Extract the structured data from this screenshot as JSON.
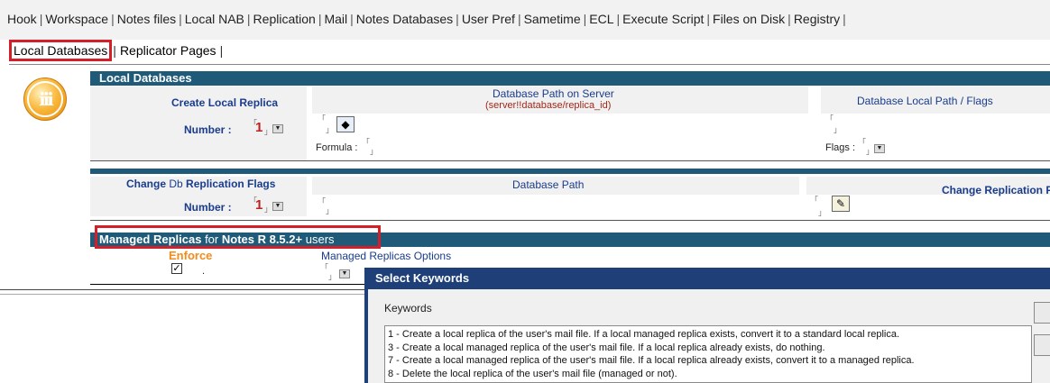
{
  "top_tabs": [
    "Hook",
    "Workspace",
    "Notes files",
    "Local NAB",
    "Replication",
    "Mail",
    "Notes Databases",
    "User Pref",
    "Sametime",
    "ECL",
    "Execute Script",
    "Files on Disk",
    "Registry"
  ],
  "sub_tabs": {
    "active": "Local Databases",
    "other": "Replicator Pages"
  },
  "local_databases": {
    "header": "Local Databases",
    "create_label": "Create Local Replica",
    "number_label": "Number :",
    "number_value": "1",
    "path_server_title": "Database Path on Server",
    "path_server_hint": "(server!!database/replica_id)",
    "formula_label": "Formula :",
    "local_path_title": "Database Local Path / Flags",
    "flags_label": "Flags :"
  },
  "change_flags": {
    "label_bold_1": "Change",
    "label_normal": "Db",
    "label_bold_2": "Replication Flags",
    "number_label": "Number :",
    "number_value": "1",
    "path_title": "Database Path",
    "change_title": "Change Replication F"
  },
  "managed": {
    "header_bold": "Managed Replicas",
    "header_normal_1": "for",
    "header_bold_2": "Notes R 8.5.2+",
    "header_normal_2": "users",
    "enforce_label": "Enforce",
    "options_label": "Managed Replicas Options",
    "enforce_checked": true
  },
  "dialog": {
    "title": "Select Keywords",
    "keywords_label": "Keywords",
    "items": [
      "1 - Create a local replica of the user's mail file. If a local managed replica exists, convert it to a standard local replica.",
      "3 - Create a local managed replica of the user's mail file. If a local replica already exists, do nothing.",
      "7 - Create a local managed replica of the user's mail file. If a local replica already exists, convert it to a managed replica.",
      "8 - Delete the local replica of the user's mail file (managed or not)."
    ]
  },
  "colors": {
    "header_bg": "#1f5a79",
    "highlight": "#d21f2a",
    "dialog_title_bg": "#1e3f77"
  }
}
